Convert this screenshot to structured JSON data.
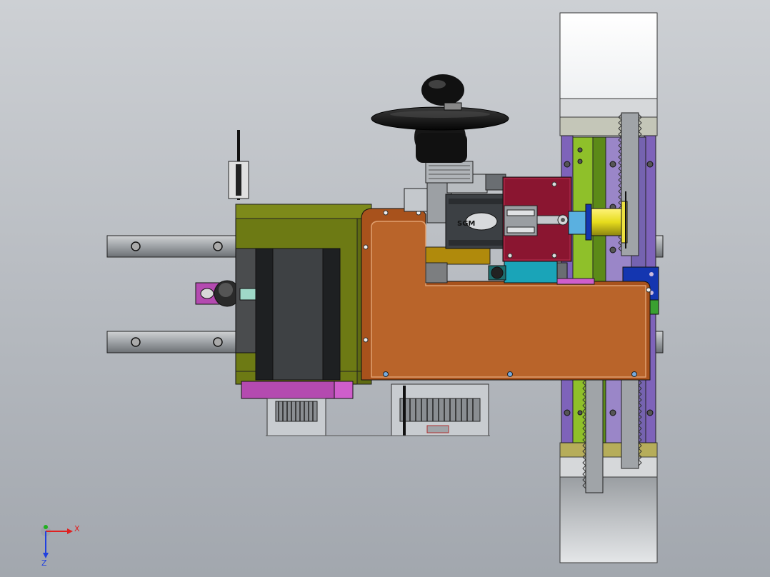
{
  "viewport": {
    "background_top": "#c9ccd0",
    "background_bottom": "#a3a8b0"
  },
  "parts": {
    "olive_body": "#6d7a14",
    "copper_plate": "#b35a20",
    "magenta_block": "#b44ab0",
    "maroon_clamp": "#8a1530",
    "purple_plate": "#7e63ba",
    "green_rail": "#8fc02a",
    "cyan_block": "#1aa4b8",
    "yellow_cylinder": "#e8e02a",
    "blue_block": "#1436b0",
    "steel": "#8a8e92",
    "black_handwheel": "#111111"
  },
  "motor_label": "SGM",
  "triad": {
    "x_label": "X",
    "z_label": "Z",
    "x_color": "#e02020",
    "y_color": "#20b020",
    "z_color": "#2040e0"
  }
}
